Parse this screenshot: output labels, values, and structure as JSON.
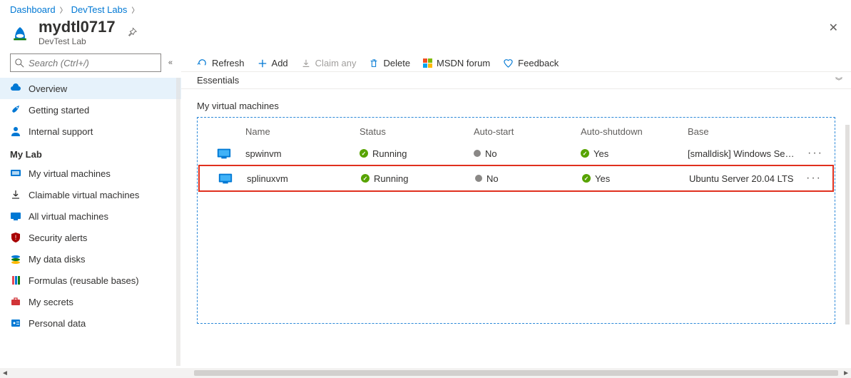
{
  "breadcrumb": {
    "items": [
      "Dashboard",
      "DevTest Labs"
    ]
  },
  "header": {
    "title": "mydtl0717",
    "subtitle": "DevTest Lab"
  },
  "search": {
    "placeholder": "Search (Ctrl+/)"
  },
  "sidebar": {
    "top": [
      {
        "label": "Overview"
      },
      {
        "label": "Getting started"
      },
      {
        "label": "Internal support"
      }
    ],
    "section_title": "My Lab",
    "lab": [
      {
        "label": "My virtual machines"
      },
      {
        "label": "Claimable virtual machines"
      },
      {
        "label": "All virtual machines"
      },
      {
        "label": "Security alerts"
      },
      {
        "label": "My data disks"
      },
      {
        "label": "Formulas (reusable bases)"
      },
      {
        "label": "My secrets"
      },
      {
        "label": "Personal data"
      }
    ]
  },
  "toolbar": {
    "refresh": "Refresh",
    "add": "Add",
    "claim": "Claim any",
    "delete": "Delete",
    "msdn": "MSDN forum",
    "feedback": "Feedback"
  },
  "essentials": {
    "label": "Essentials"
  },
  "vm_section": {
    "title": "My virtual machines"
  },
  "vm_table": {
    "headers": {
      "name": "Name",
      "status": "Status",
      "autostart": "Auto-start",
      "autoshutdown": "Auto-shutdown",
      "base": "Base"
    },
    "rows": [
      {
        "name": "spwinvm",
        "status": "Running",
        "autostart": "No",
        "autoshutdown": "Yes",
        "base": "[smalldisk] Windows Se…"
      },
      {
        "name": "splinuxvm",
        "status": "Running",
        "autostart": "No",
        "autoshutdown": "Yes",
        "base": "Ubuntu Server 20.04 LTS"
      }
    ]
  }
}
